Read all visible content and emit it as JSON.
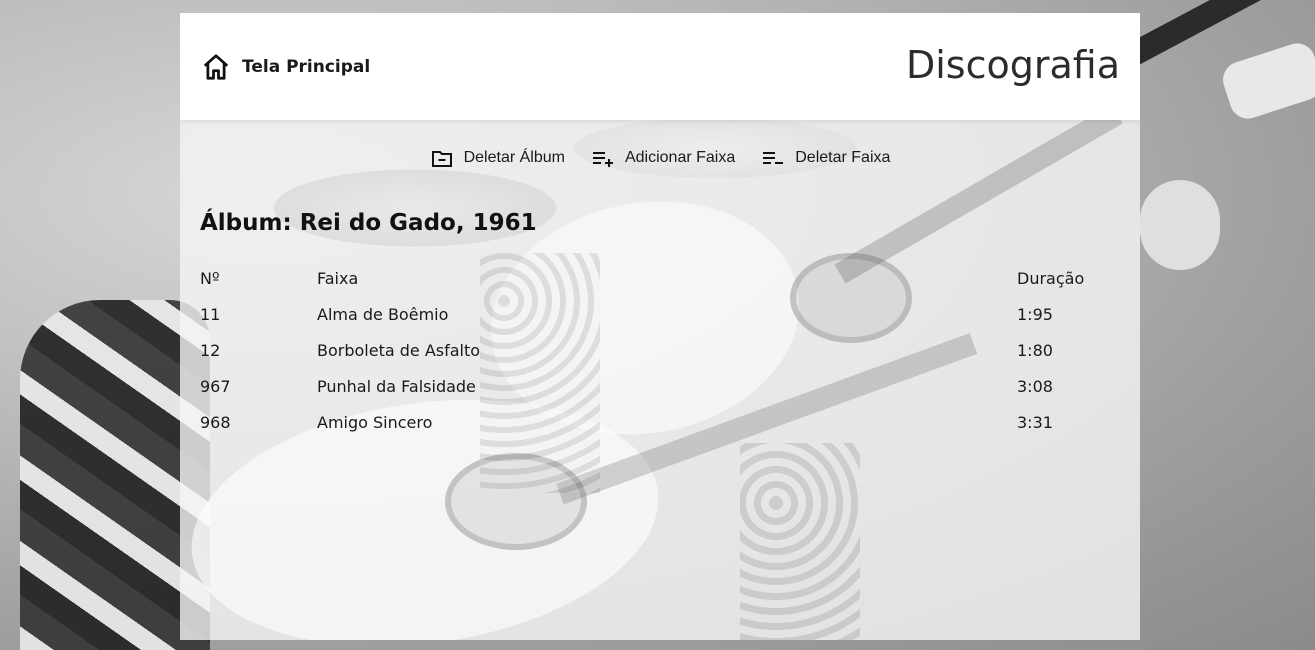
{
  "header": {
    "home_label": "Tela Principal",
    "title": "Discografia"
  },
  "toolbar": {
    "delete_album_label": "Deletar Álbum",
    "add_track_label": "Adicionar Faixa",
    "delete_track_label": "Deletar Faixa"
  },
  "album": {
    "heading": "Álbum: Rei do Gado, 1961"
  },
  "table": {
    "headers": {
      "number": "Nº",
      "track": "Faixa",
      "duration": "Duração"
    },
    "rows": [
      {
        "number": "11",
        "track": "Alma de Boêmio",
        "duration": "1:95"
      },
      {
        "number": "12",
        "track": "Borboleta de Asfalto",
        "duration": "1:80"
      },
      {
        "number": "967",
        "track": "Punhal da Falsidade",
        "duration": "3:08"
      },
      {
        "number": "968",
        "track": "Amigo Sincero",
        "duration": "3:31"
      }
    ]
  },
  "icons": {
    "home": "home-icon",
    "delete_album": "folder-minus-icon",
    "add_track": "playlist-add-icon",
    "delete_track": "playlist-remove-icon"
  },
  "colors": {
    "text": "#1a1a1a",
    "header_bg": "#ffffff",
    "card_bg": "#f5f5f5"
  }
}
